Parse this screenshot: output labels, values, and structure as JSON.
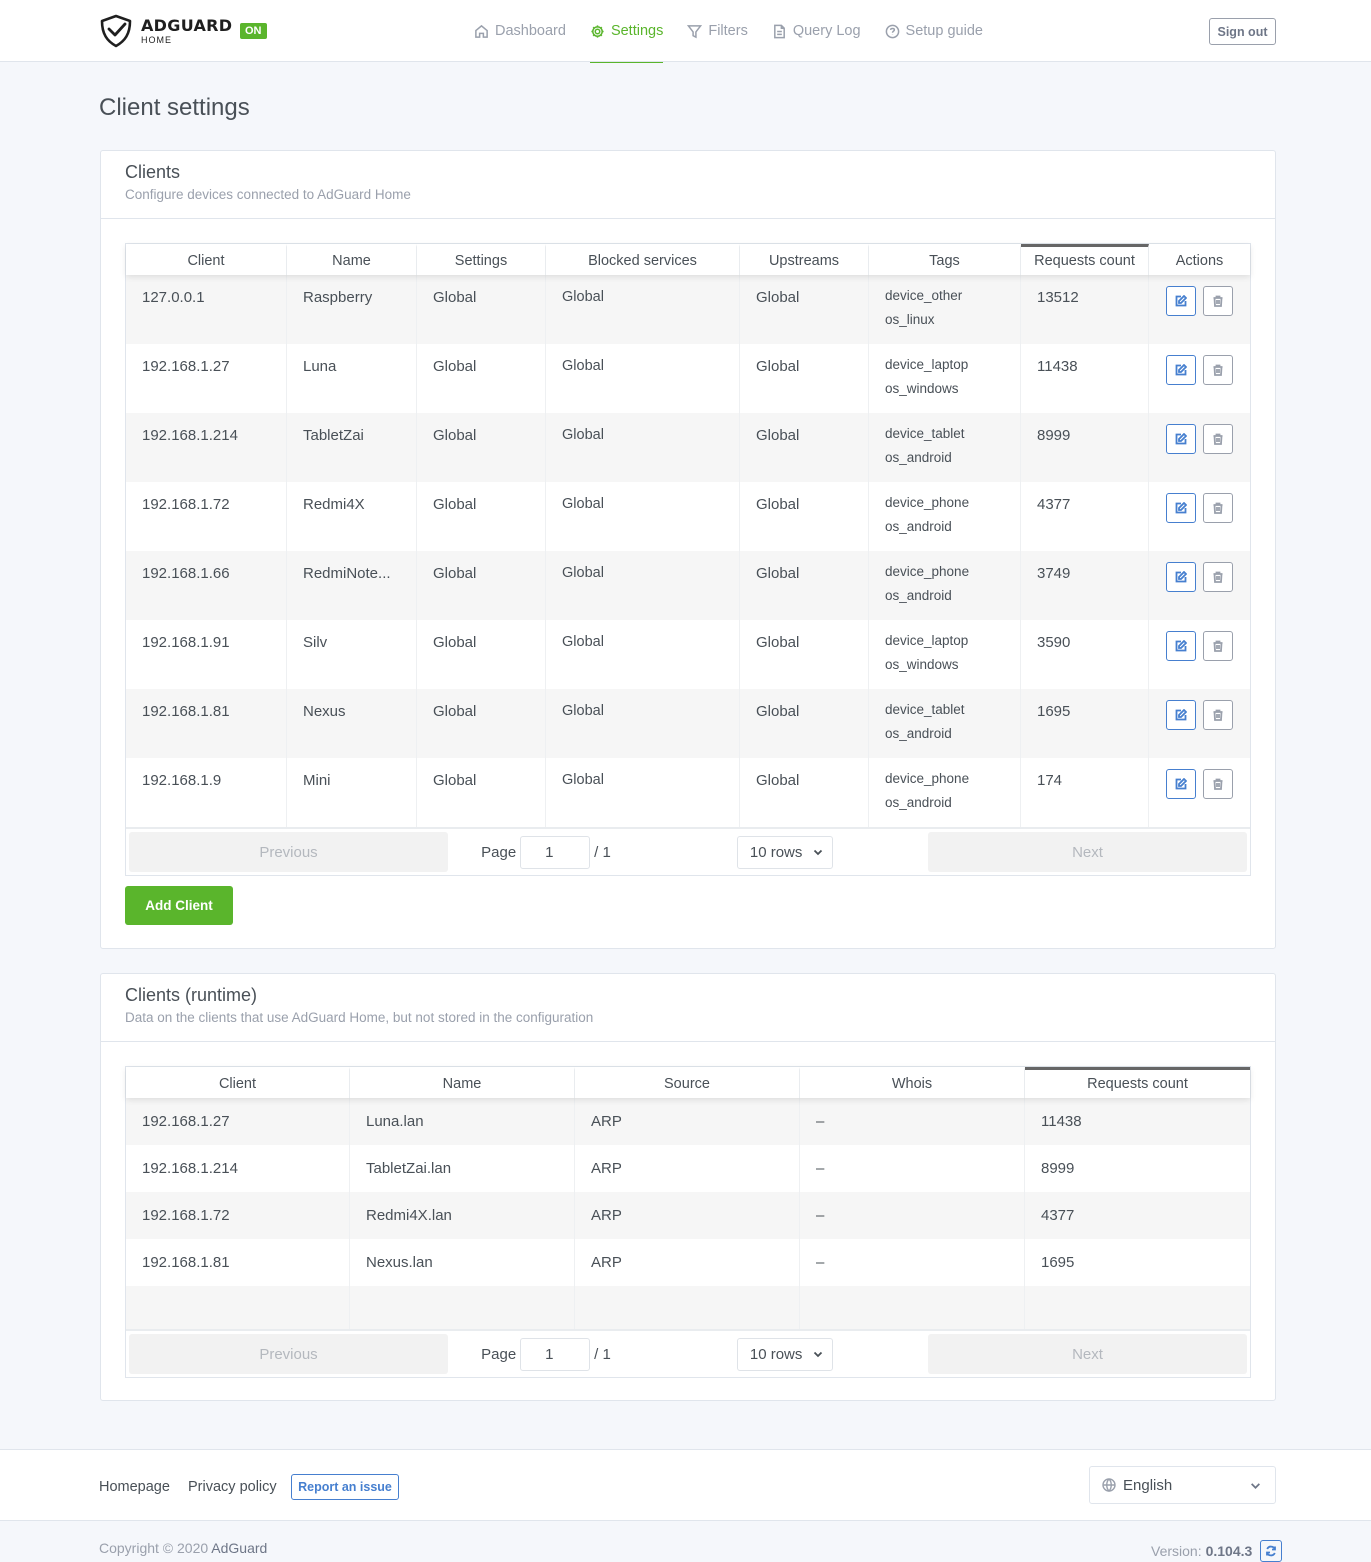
{
  "brand": {
    "name": "ADGUARD",
    "sub": "HOME",
    "status": "ON"
  },
  "nav": [
    {
      "label": "Dashboard",
      "icon": "home-icon",
      "active": false
    },
    {
      "label": "Settings",
      "icon": "gear-icon",
      "active": true
    },
    {
      "label": "Filters",
      "icon": "filter-icon",
      "active": false
    },
    {
      "label": "Query Log",
      "icon": "document-icon",
      "active": false
    },
    {
      "label": "Setup guide",
      "icon": "help-circle-icon",
      "active": false
    }
  ],
  "signout_label": "Sign out",
  "page_title": "Client settings",
  "clients_card": {
    "title": "Clients",
    "subtitle": "Configure devices connected to AdGuard Home",
    "columns": [
      "Client",
      "Name",
      "Settings",
      "Blocked services",
      "Upstreams",
      "Tags",
      "Requests count",
      "Actions"
    ],
    "sorted_column": "Requests count",
    "rows": [
      {
        "client": "127.0.0.1",
        "name": "Raspberry",
        "settings": "Global",
        "blocked": "Global",
        "upstreams": "Global",
        "tag1": "device_other",
        "tag2": "os_linux",
        "count": "13512"
      },
      {
        "client": "192.168.1.27",
        "name": "Luna",
        "settings": "Global",
        "blocked": "Global",
        "upstreams": "Global",
        "tag1": "device_laptop",
        "tag2": "os_windows",
        "count": "11438"
      },
      {
        "client": "192.168.1.214",
        "name": "TabletZai",
        "settings": "Global",
        "blocked": "Global",
        "upstreams": "Global",
        "tag1": "device_tablet",
        "tag2": "os_android",
        "count": "8999"
      },
      {
        "client": "192.168.1.72",
        "name": "Redmi4X",
        "settings": "Global",
        "blocked": "Global",
        "upstreams": "Global",
        "tag1": "device_phone",
        "tag2": "os_android",
        "count": "4377"
      },
      {
        "client": "192.168.1.66",
        "name": "RedmiNote...",
        "settings": "Global",
        "blocked": "Global",
        "upstreams": "Global",
        "tag1": "device_phone",
        "tag2": "os_android",
        "count": "3749"
      },
      {
        "client": "192.168.1.91",
        "name": "Silv",
        "settings": "Global",
        "blocked": "Global",
        "upstreams": "Global",
        "tag1": "device_laptop",
        "tag2": "os_windows",
        "count": "3590"
      },
      {
        "client": "192.168.1.81",
        "name": "Nexus",
        "settings": "Global",
        "blocked": "Global",
        "upstreams": "Global",
        "tag1": "device_tablet",
        "tag2": "os_android",
        "count": "1695"
      },
      {
        "client": "192.168.1.9",
        "name": "Mini",
        "settings": "Global",
        "blocked": "Global",
        "upstreams": "Global",
        "tag1": "device_phone",
        "tag2": "os_android",
        "count": "174"
      }
    ],
    "pager": {
      "previous": "Previous",
      "page_label": "Page",
      "page": "1",
      "of": "/ 1",
      "rows": "10 rows",
      "next": "Next"
    },
    "add_button": "Add Client"
  },
  "runtime_card": {
    "title": "Clients (runtime)",
    "subtitle": "Data on the clients that use AdGuard Home, but not stored in the configuration",
    "columns": [
      "Client",
      "Name",
      "Source",
      "Whois",
      "Requests count"
    ],
    "sorted_column": "Requests count",
    "rows": [
      {
        "client": "192.168.1.27",
        "name": "Luna.lan",
        "source": "ARP",
        "whois": "–",
        "count": "11438"
      },
      {
        "client": "192.168.1.214",
        "name": "TabletZai.lan",
        "source": "ARP",
        "whois": "–",
        "count": "8999"
      },
      {
        "client": "192.168.1.72",
        "name": "Redmi4X.lan",
        "source": "ARP",
        "whois": "–",
        "count": "4377"
      },
      {
        "client": "192.168.1.81",
        "name": "Nexus.lan",
        "source": "ARP",
        "whois": "–",
        "count": "1695"
      }
    ],
    "pager": {
      "previous": "Previous",
      "page_label": "Page",
      "page": "1",
      "of": "/ 1",
      "rows": "10 rows",
      "next": "Next"
    }
  },
  "footer": {
    "homepage": "Homepage",
    "privacy": "Privacy policy",
    "report": "Report an issue",
    "language": "English",
    "copyright_prefix": "Copyright © 2020",
    "copyright_owner": "AdGuard",
    "version_label": "Version:",
    "version": "0.104.3"
  },
  "colors": {
    "accent": "#5ab52c",
    "link": "#467fcf",
    "muted": "#9aa0ac"
  }
}
